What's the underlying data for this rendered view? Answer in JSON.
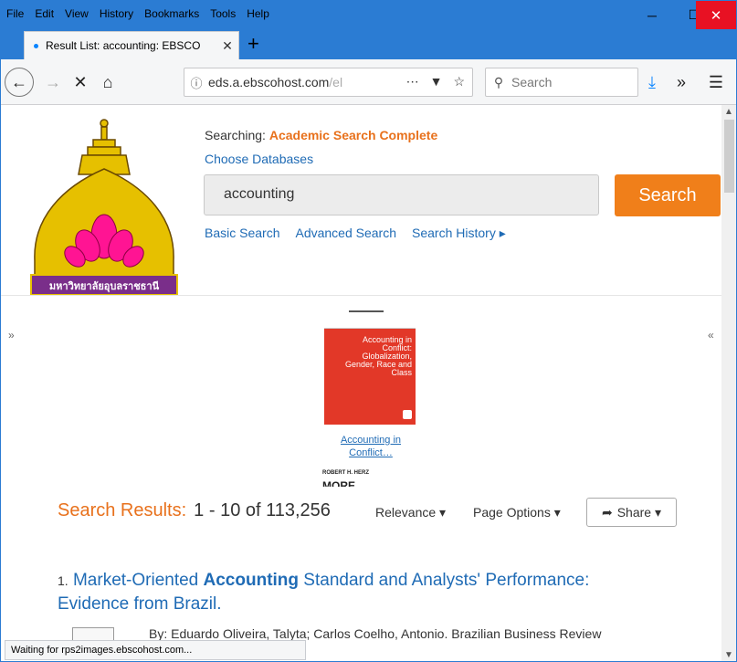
{
  "menubar": {
    "items": [
      {
        "label": "File"
      },
      {
        "label": "Edit"
      },
      {
        "label": "View"
      },
      {
        "label": "History"
      },
      {
        "label": "Bookmarks"
      },
      {
        "label": "Tools"
      },
      {
        "label": "Help"
      }
    ]
  },
  "tab": {
    "title": "Result List: accounting: EBSCO"
  },
  "navbar": {
    "url_host": "eds.a.ebscohost.com",
    "url_rest": "/el",
    "search_placeholder": "Search"
  },
  "header": {
    "searching_label": "Searching:",
    "database": "Academic Search Complete",
    "choose_databases": "Choose Databases",
    "query": "accounting",
    "search_button": "Search",
    "links": [
      "Basic Search",
      "Advanced Search",
      "Search History ▸"
    ],
    "logo_text": "มหาวิทยาลัยอุบลราชธานี"
  },
  "book": {
    "title_on_cover": "Accounting in Conflict: Globalization, Gender, Race and Class",
    "caption": "Accounting in Conflict…",
    "author": "ROBERT H. HERZ",
    "more": "MORE"
  },
  "results": {
    "label": "Search Results:",
    "count": "1 - 10 of 113,256",
    "sort": "Relevance ▾",
    "page_options": "Page Options ▾",
    "share": "Share ▾"
  },
  "result1": {
    "num": "1.",
    "title_a": "Market-Oriented ",
    "title_b": "Accounting",
    "title_c": " Standard and Analysts' Performance: Evidence from Brazil.",
    "byline": "By: Eduardo Oliveira, Talyta; Carlos Coelho, Antonio. Brazilian Business Review"
  },
  "status": {
    "text": "Waiting for rps2images.ebscohost.com..."
  },
  "colors": {
    "accent": "#e8711c",
    "link": "#1f6bb5",
    "titlebar": "#2b7cd3"
  }
}
